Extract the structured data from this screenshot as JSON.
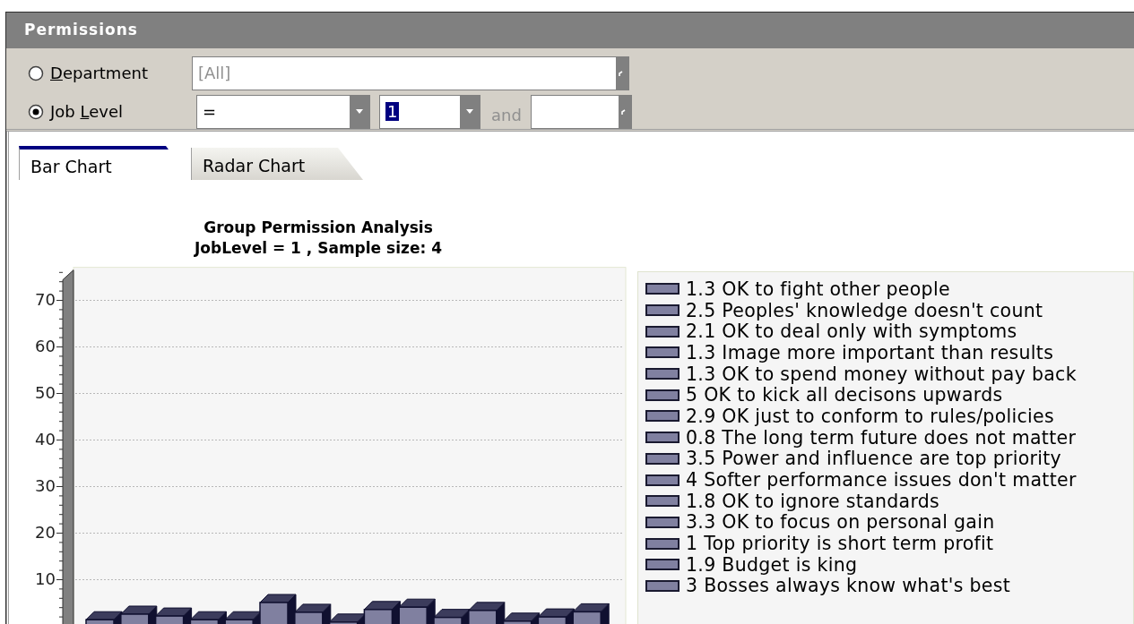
{
  "panel": {
    "title": "Permissions"
  },
  "filters": [
    {
      "kind": "text",
      "access_key": "D",
      "label_after": "epartment",
      "selected": false,
      "value": "[All]"
    },
    {
      "kind": "range",
      "label_before": "Job ",
      "access_key": "L",
      "label_after": "evel",
      "selected": true,
      "operator": "=",
      "value": "1",
      "joiner": "and"
    }
  ],
  "tabs": [
    {
      "label": "Bar Chart",
      "selected": true
    },
    {
      "label": "Radar Chart",
      "selected": false
    }
  ],
  "chart": {
    "subtitle": "JobLevel = 1 , Sample size: 4",
    "chart_data": {
      "type": "bar",
      "title": "Group Permission Analysis",
      "grid": true,
      "ylim": [
        0,
        77
      ],
      "yticks": [
        10,
        20,
        30,
        40,
        50,
        60,
        70
      ],
      "series": [
        {
          "color": "#8080a0",
          "values": [
            1.3,
            2.5,
            2.1,
            1.3,
            1.3,
            5,
            2.9,
            0.8,
            3.5,
            4,
            1.8,
            3.3,
            1,
            1.9,
            3
          ]
        }
      ]
    },
    "legend": [
      "1.3 OK to fight other people",
      "2.5 Peoples' knowledge doesn't count",
      "2.1 OK to deal only with symptoms",
      "1.3 Image more important than results",
      "1.3 OK to spend money without pay back",
      "5 OK to kick all decisons upwards",
      "2.9 OK just to conform to rules/policies",
      "0.8 The long term future does not matter",
      "3.5 Power and influence are top priority",
      "4 Softer performance issues don't matter",
      "1.8 OK to ignore standards",
      "3.3 OK to focus on personal gain",
      "1 Top priority is short term profit",
      "1.9 Budget is king",
      "3 Bosses always know what's best"
    ]
  }
}
